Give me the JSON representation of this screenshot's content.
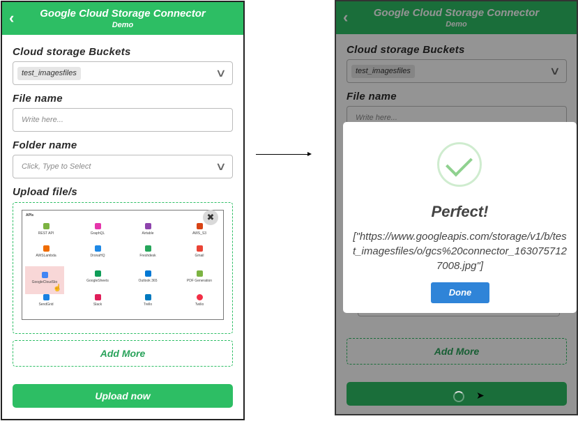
{
  "header": {
    "title": "Google Cloud Storage Connector",
    "subtitle": "Demo"
  },
  "form": {
    "buckets_label": "Cloud storage Buckets",
    "bucket_value": "test_imagesfiles",
    "filename_label": "File name",
    "filename_placeholder": "Write here...",
    "folder_label": "Folder name",
    "folder_placeholder": "Click, Type to Select",
    "upload_label": "Upload file/s",
    "add_more": "Add More",
    "upload_button": "Upload now"
  },
  "thumbnail": {
    "section": "APIs",
    "tiles": [
      "REST API",
      "GraphQL",
      "Airtable",
      "AWS_S3",
      "AWSLambda",
      "DronaHQ",
      "Freshdesk",
      "Gmail",
      "GoogleCloudSto",
      "GoogleSheets",
      "Outlook 365",
      "PDF Generation",
      "SendGrid",
      "Slack",
      "Trello",
      "Twilio"
    ]
  },
  "modal": {
    "title": "Perfect!",
    "message": "[\"https://www.googleapis.com/storage/v1/b/test_imagesfiles/o/gcs%20connector_1630757127008.jpg\"]",
    "done": "Done"
  },
  "colors": {
    "accent": "#2dbe64",
    "done_button": "#2f84d8",
    "selected_tile": "#f8d7d7"
  }
}
